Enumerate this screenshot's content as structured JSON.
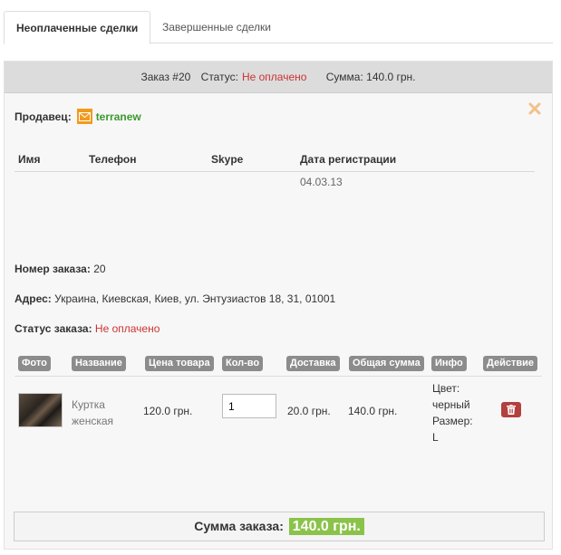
{
  "tabs": {
    "active_label": "Неоплаченные сделки",
    "inactive_label": "Завершенные сделки"
  },
  "order_header": {
    "order_label": "Заказ #20",
    "status_label": "Статус:",
    "status_value": "Не оплачено",
    "sum_label": "Сумма: 140.0 грн."
  },
  "seller": {
    "label": "Продавец:",
    "name": "terranew"
  },
  "contact_table": {
    "headers": [
      "Имя",
      "Телефон",
      "Skype",
      "Дата регистрации"
    ],
    "row": [
      "",
      "",
      "",
      "04.03.13"
    ]
  },
  "order_info": {
    "number_label": "Номер заказа:",
    "number_value": "20",
    "address_label": "Адрес:",
    "address_value": "Украина, Киевская, Киев, ул. Энтузиастов 18, 31, 01001",
    "status_label": "Статус заказа:",
    "status_value": "Не оплачено"
  },
  "items_table": {
    "headers": [
      "Фото",
      "Название",
      "Цена товара",
      "Кол-во",
      "Доставка",
      "Общая сумма",
      "Инфо",
      "Действие"
    ],
    "rows": [
      {
        "name_line1": "Куртка",
        "name_line2": "женская",
        "price": "120.0 грн.",
        "qty": "1",
        "delivery": "20.0 грн.",
        "total": "140.0 грн.",
        "info_line1": "Цвет:",
        "info_line2": "черный",
        "info_line3": "Размер:",
        "info_line4": "L"
      }
    ]
  },
  "footer": {
    "total_label": "Сумма заказа:",
    "total_value": "140.0 грн."
  },
  "colors": {
    "status_red": "#cc3333",
    "seller_green": "#3a9a2f",
    "total_green": "#8bc34a",
    "delete_red": "#b3403e"
  },
  "icons": [
    "mail-icon",
    "close-icon",
    "trash-icon"
  ]
}
